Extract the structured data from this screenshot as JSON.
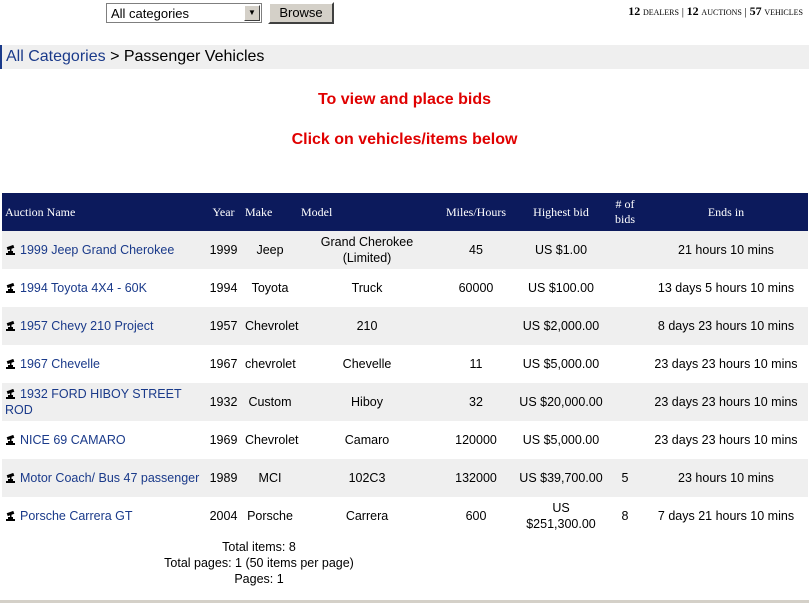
{
  "search": {
    "category_selected": "All categories",
    "browse_label": "Browse"
  },
  "stats": {
    "dealers_count": "12",
    "dealers_label": "dealers",
    "auctions_count": "12",
    "auctions_label": "auctions",
    "vehicles_count": "57",
    "vehicles_label": "vehicles",
    "separator": "|"
  },
  "breadcrumb": {
    "root": "All Categories",
    "separator": ">",
    "current": "Passenger Vehicles"
  },
  "promo": {
    "line1": "To view and place bids",
    "line2": "Click on vehicles/items below"
  },
  "table": {
    "headers": [
      "Auction Name",
      "Year",
      "Make",
      "Model",
      "Miles/Hours",
      "Highest bid",
      "# of bids",
      "Ends in"
    ],
    "rows": [
      {
        "name": "1999 Jeep Grand Cherokee",
        "year": "1999",
        "make": "Jeep",
        "model": "Grand Cherokee (Limited)",
        "miles": "45",
        "bid": "US $1.00",
        "bids": "",
        "ends": "21 hours 10 mins"
      },
      {
        "name": "1994 Toyota 4X4 - 60K",
        "year": "1994",
        "make": "Toyota",
        "model": "Truck",
        "miles": "60000",
        "bid": "US $100.00",
        "bids": "",
        "ends": "13 days 5 hours 10 mins"
      },
      {
        "name": "1957 Chevy 210 Project",
        "year": "1957",
        "make": "Chevrolet",
        "model": "210",
        "miles": "",
        "bid": "US $2,000.00",
        "bids": "",
        "ends": "8 days 23 hours 10 mins"
      },
      {
        "name": "1967 Chevelle",
        "year": "1967",
        "make": "chevrolet",
        "model": "Chevelle",
        "miles": "11",
        "bid": "US $5,000.00",
        "bids": "",
        "ends": "23 days 23 hours 10 mins"
      },
      {
        "name": "1932 FORD HIBOY STREET ROD",
        "year": "1932",
        "make": "Custom",
        "model": "Hiboy",
        "miles": "32",
        "bid": "US $20,000.00",
        "bids": "",
        "ends": "23 days 23 hours 10 mins"
      },
      {
        "name": "NICE 69 CAMARO",
        "year": "1969",
        "make": "Chevrolet",
        "model": "Camaro",
        "miles": "120000",
        "bid": "US $5,000.00",
        "bids": "",
        "ends": "23 days 23 hours 10 mins"
      },
      {
        "name": "Motor Coach/ Bus 47 passenger",
        "year": "1989",
        "make": "MCI",
        "model": "102C3",
        "miles": "132000",
        "bid": "US $39,700.00",
        "bids": "5",
        "ends": "23 hours 10 mins"
      },
      {
        "name": "Porsche Carrera GT",
        "year": "2004",
        "make": "Porsche",
        "model": "Carrera",
        "miles": "600",
        "bid": "US $251,300.00",
        "bids": "8",
        "ends": "7 days 21 hours 10 mins"
      }
    ]
  },
  "footer": {
    "total_items": "Total items: 8",
    "total_pages": "Total pages: 1 (50 items per page)",
    "pages": "Pages: 1"
  },
  "icons": {
    "auction_icon": "gavel-icon",
    "dropdown_icon": "chevron-down-icon"
  },
  "colors": {
    "header_bg": "#0c1a5c",
    "link": "#1a3a8a",
    "promo": "#e00000",
    "row_alt": "#efefef"
  }
}
